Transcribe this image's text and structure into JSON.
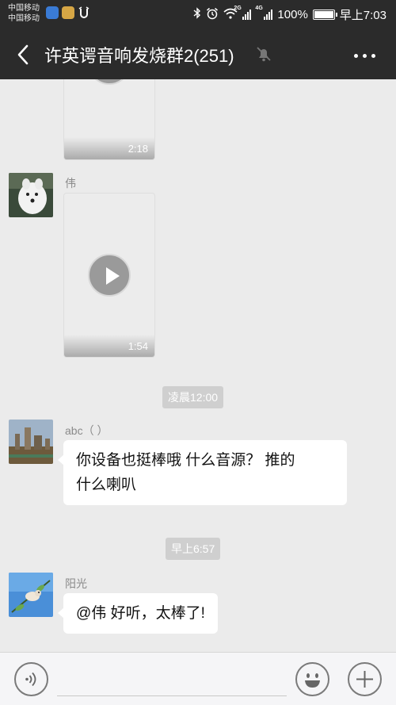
{
  "status_bar": {
    "carrier_1": "中国移动",
    "carrier_2": "中国移动",
    "battery": "100%",
    "time": "早上7:03",
    "net_1": "2G",
    "net_2": "4G",
    "battery_level": 1.0
  },
  "header": {
    "title": "许英谔音响发烧群2(251)",
    "back_icon": "chevron-left-icon",
    "mute_icon": "bell-off-icon",
    "more_icon": "more-dots-icon"
  },
  "messages": [
    {
      "type": "video",
      "duration": "2:18"
    },
    {
      "type": "video",
      "sender": "伟",
      "duration": "1:54"
    },
    {
      "type": "timestamp",
      "text": "凌晨12:00"
    },
    {
      "type": "text",
      "sender": "abc（ ）",
      "line1": "你设备也挺棒哦  什么音源？  推的",
      "line2": "什么喇叭"
    },
    {
      "type": "timestamp",
      "text": "早上6:57"
    },
    {
      "type": "text",
      "sender": "阳光",
      "line1": "@伟   好听，太棒了!"
    }
  ],
  "input_bar": {
    "voice_icon": "voice-icon",
    "emoji_icon": "emoji-icon",
    "plus_icon": "plus-icon",
    "text_value": ""
  },
  "colors": {
    "bar": "#2b2b2b",
    "chat_bg": "#ebebeb",
    "timestamp_bg": "#cfcfcf"
  }
}
